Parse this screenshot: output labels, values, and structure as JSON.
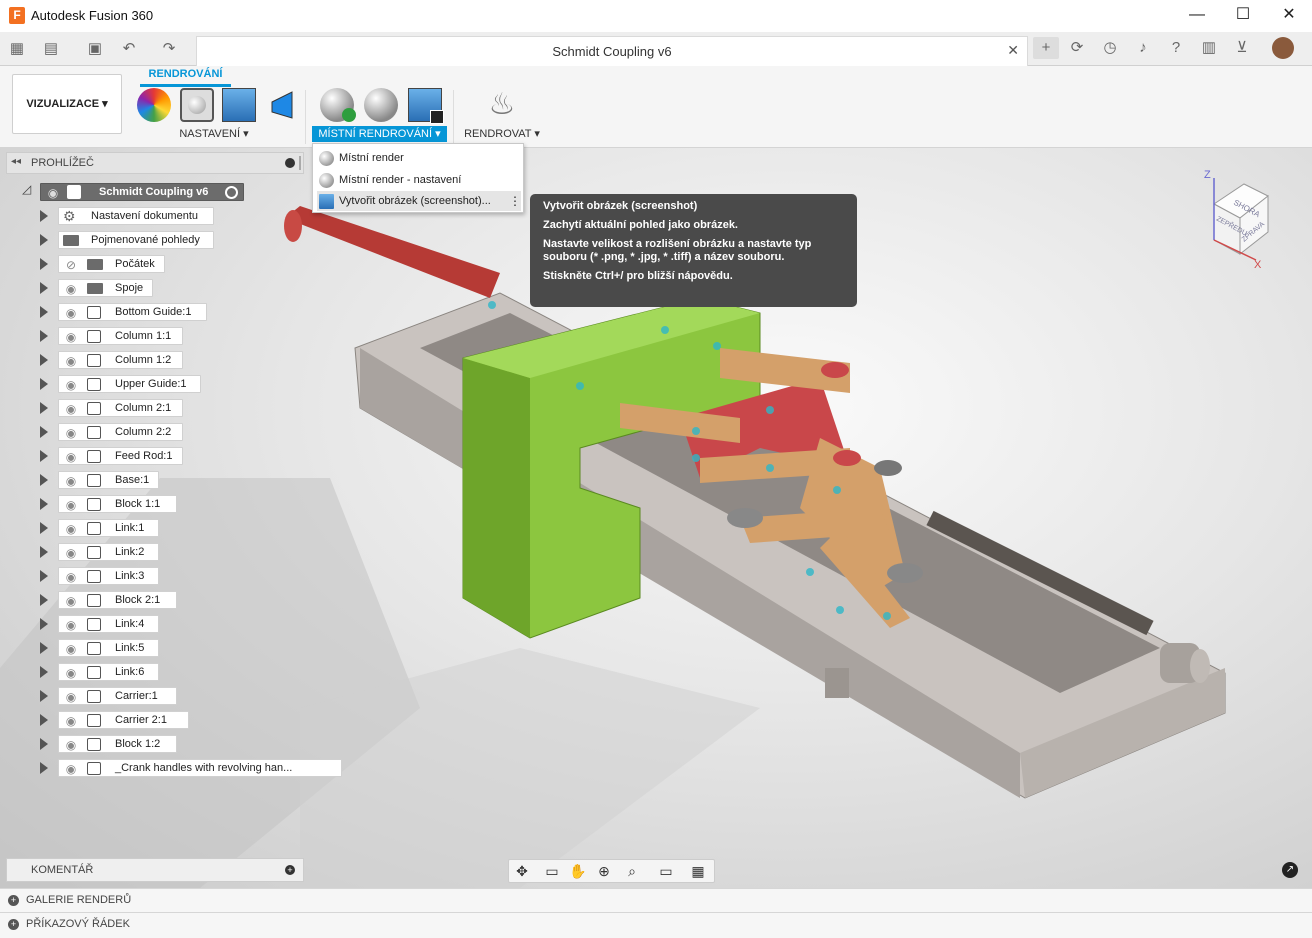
{
  "window": {
    "app_title": "Autodesk Fusion 360",
    "minimize": "—",
    "maximize": "☐",
    "close": "✕"
  },
  "document_tab": {
    "title": "Schmidt Coupling v6",
    "close": "✕"
  },
  "workspace": {
    "label": "VIZUALIZACE"
  },
  "ribbon": {
    "active_tab": "RENDROVÁNÍ",
    "groups": [
      {
        "label": "NASTAVENÍ"
      },
      {
        "label": "MÍSTNÍ RENDROVÁNÍ"
      },
      {
        "label": "RENDROVAT"
      }
    ]
  },
  "browser": {
    "title": "PROHLÍŽEČ",
    "root": "Schmidt Coupling v6",
    "items": [
      {
        "label": "Nastavení dokumentu",
        "icon": "gear-icon"
      },
      {
        "label": "Pojmenované pohledy",
        "icon": "folder-icon"
      },
      {
        "label": "Počátek",
        "icon": "folder-icon"
      },
      {
        "label": "Spoje",
        "icon": "folder-icon"
      },
      {
        "label": "Bottom Guide:1",
        "icon": "component-icon"
      },
      {
        "label": "Column 1:1",
        "icon": "component-icon"
      },
      {
        "label": "Column 1:2",
        "icon": "component-icon"
      },
      {
        "label": "Upper Guide:1",
        "icon": "component-icon"
      },
      {
        "label": "Column 2:1",
        "icon": "component-icon"
      },
      {
        "label": "Column 2:2",
        "icon": "component-icon"
      },
      {
        "label": "Feed Rod:1",
        "icon": "component-icon"
      },
      {
        "label": "Base:1",
        "icon": "component-icon"
      },
      {
        "label": "Block 1:1",
        "icon": "component-icon"
      },
      {
        "label": "Link:1",
        "icon": "component-icon"
      },
      {
        "label": "Link:2",
        "icon": "component-icon"
      },
      {
        "label": "Link:3",
        "icon": "component-icon"
      },
      {
        "label": "Block 2:1",
        "icon": "component-icon"
      },
      {
        "label": "Link:4",
        "icon": "component-icon"
      },
      {
        "label": "Link:5",
        "icon": "component-icon"
      },
      {
        "label": "Link:6",
        "icon": "component-icon"
      },
      {
        "label": "Carrier:1",
        "icon": "component-icon"
      },
      {
        "label": "Carrier 2:1",
        "icon": "component-icon"
      },
      {
        "label": "Block 1:2",
        "icon": "component-icon"
      },
      {
        "label": "_Crank handles with revolving han...",
        "icon": "component-icon"
      }
    ]
  },
  "dropdown": {
    "items": [
      {
        "label": "Místní render"
      },
      {
        "label": "Místní render - nastavení"
      },
      {
        "label": "Vytvořit obrázek (screenshot)..."
      }
    ]
  },
  "tooltip": {
    "title": "Vytvořit obrázek (screenshot)",
    "line1": "Zachytí aktuální pohled jako obrázek.",
    "line2": "Nastavte velikost a rozlišení obrázku a nastavte typ souboru (* .png, * .jpg, * .tiff) a název souboru.",
    "line3": "Stiskněte Ctrl+/ pro bližší nápovědu."
  },
  "viewcube": {
    "top": "SHORA",
    "front": "ZEPŘEDU",
    "right": "ZPRAVA",
    "axis_z": "Z",
    "axis_x": "X"
  },
  "comments": {
    "label": "KOMENTÁŘ"
  },
  "bottom": {
    "galleries": "GALERIE RENDERŮ",
    "command_line": "PŘÍKAZOVÝ ŘÁDEK"
  },
  "colors": {
    "accent": "#0696d7",
    "green_part": "#8cc63f",
    "red_part": "#c0453f",
    "orange_part": "#d4a06a"
  }
}
